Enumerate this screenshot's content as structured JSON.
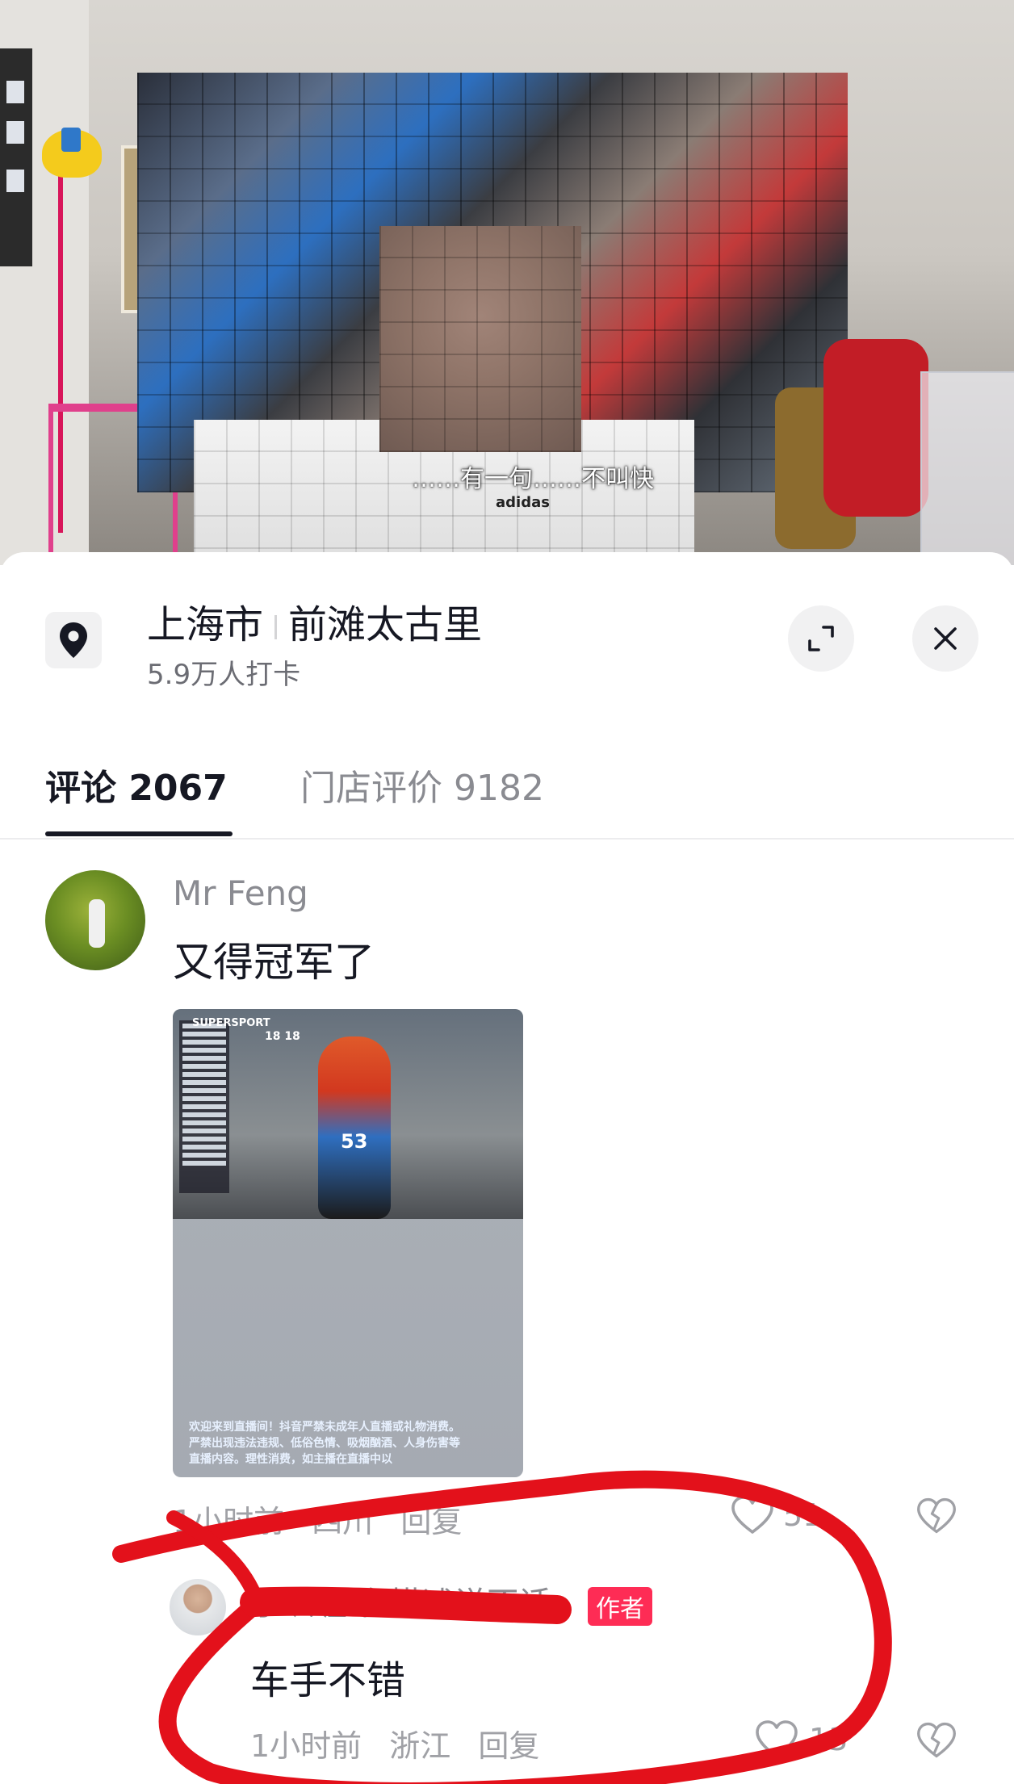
{
  "video": {
    "caption": "……有一句……不叫快",
    "shirt_logo": "adidas"
  },
  "location": {
    "city": "上海市",
    "place": "前滩太古里",
    "checkins": "5.9万人打卡"
  },
  "tabs": [
    {
      "label": "评论 2067"
    },
    {
      "label": "门店评价 9182"
    }
  ],
  "comment": {
    "username": "Mr Feng",
    "text": "又得冠军了",
    "image": {
      "overlay_title": "SUPERSPORT",
      "race_clock": "18 18",
      "rider_number": "53",
      "live_notice": "欢迎来到直播间！抖音严禁未成年人直播或礼物消费。严禁出现违法违规、低俗色情、吸烟酗酒、人身伤害等直播内容。理性消费，如主播在直播中以"
    },
    "time": "1小时前",
    "region": "四川",
    "reply_label": "回复",
    "likes": "51"
  },
  "reply": {
    "username": "小飒喔 在描述说不话",
    "badge": "作者",
    "text": "车手不错",
    "time": "1小时前",
    "region": "浙江",
    "reply_label": "回复",
    "likes": "13"
  },
  "colors": {
    "annotation_red": "#e3111b",
    "author_badge": "#fe2c55",
    "text_primary": "#161823",
    "text_secondary": "#8a8b91"
  }
}
